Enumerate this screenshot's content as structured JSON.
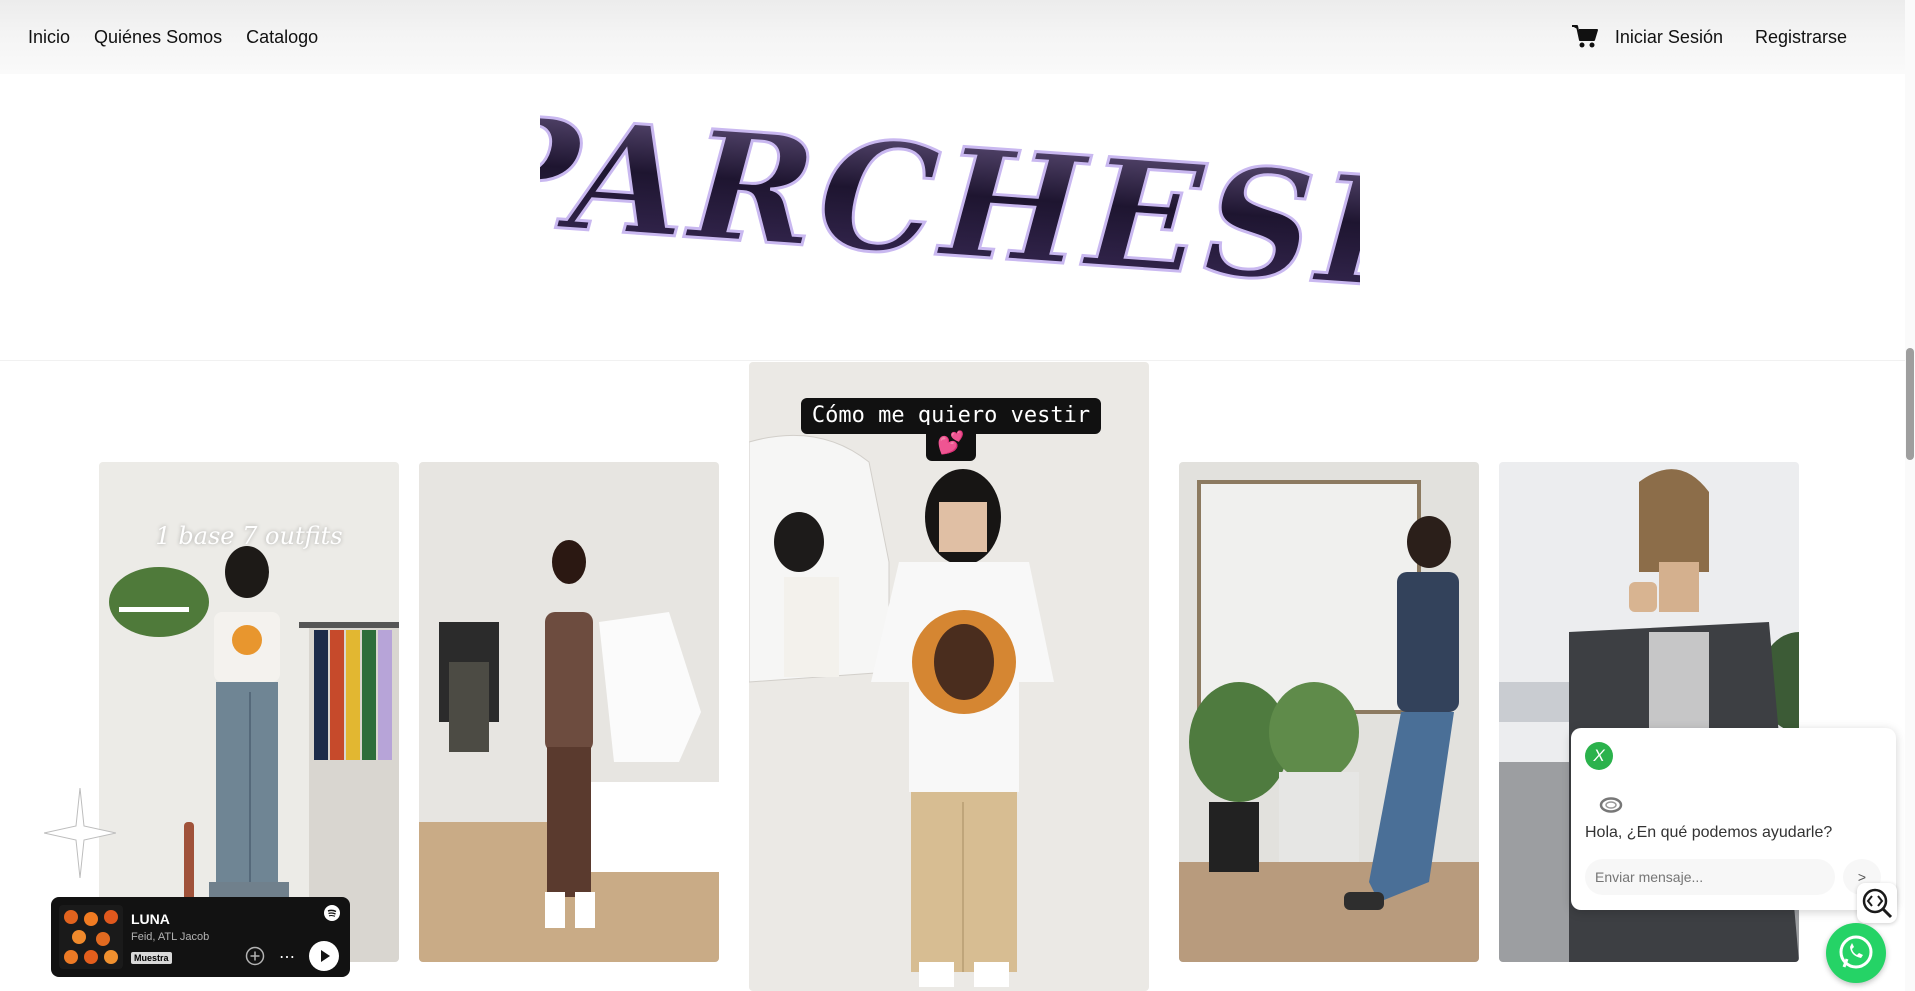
{
  "nav": {
    "links": [
      "Inicio",
      "Quiénes Somos",
      "Catalogo"
    ],
    "cart_icon": "shopping-cart-icon",
    "login": "Iniciar Sesión",
    "register": "Registrarse"
  },
  "brand": {
    "logo_text": "PARCHESE",
    "logo_color": "#2c1d45"
  },
  "gallery": {
    "cards": [
      {
        "caption": "1 base 7 outfits"
      },
      {
        "caption": ""
      },
      {
        "caption": "Cómo me quiero vestir",
        "emoji": "💕"
      },
      {
        "caption": ""
      },
      {
        "caption": ""
      }
    ]
  },
  "player": {
    "title": "LUNA",
    "artist": "Feid, ATL Jacob",
    "badge": "Muestra",
    "more": "⋯",
    "icons": [
      "spotify-icon",
      "add-icon",
      "play-icon"
    ]
  },
  "chat": {
    "close": "X",
    "greeting": "Hola, ¿En qué podemos ayudarle?",
    "placeholder": "Enviar mensaje...",
    "send": ">"
  },
  "colors": {
    "accent_green": "#2bb24c",
    "whatsapp": "#25d366",
    "player_bg": "#121212"
  }
}
